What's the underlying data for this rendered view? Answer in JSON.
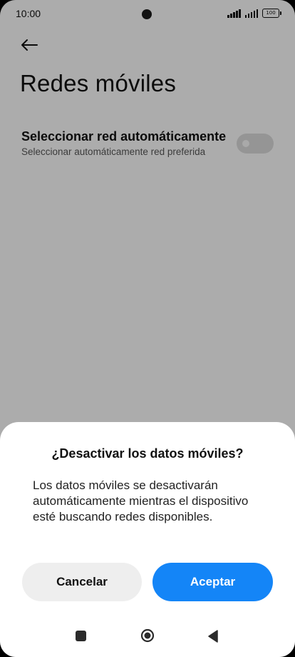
{
  "status_bar": {
    "time": "10:00",
    "battery": "100"
  },
  "header": {
    "back_icon": "arrow-left-icon",
    "title": "Redes móviles"
  },
  "setting": {
    "title": "Seleccionar red automáticamente",
    "subtitle": "Seleccionar automáticamente red preferida",
    "toggle_on": false
  },
  "dialog": {
    "title": "¿Desactivar los datos móviles?",
    "message": "Los datos móviles se desactivarán automáticamente mientras el dispositivo esté buscando redes disponibles.",
    "cancel_label": "Cancelar",
    "accept_label": "Aceptar",
    "accent_color": "#1485f7"
  },
  "nav_bar": {
    "recents_icon": "square-icon",
    "home_icon": "circle-home-icon",
    "back_icon": "triangle-back-icon"
  }
}
